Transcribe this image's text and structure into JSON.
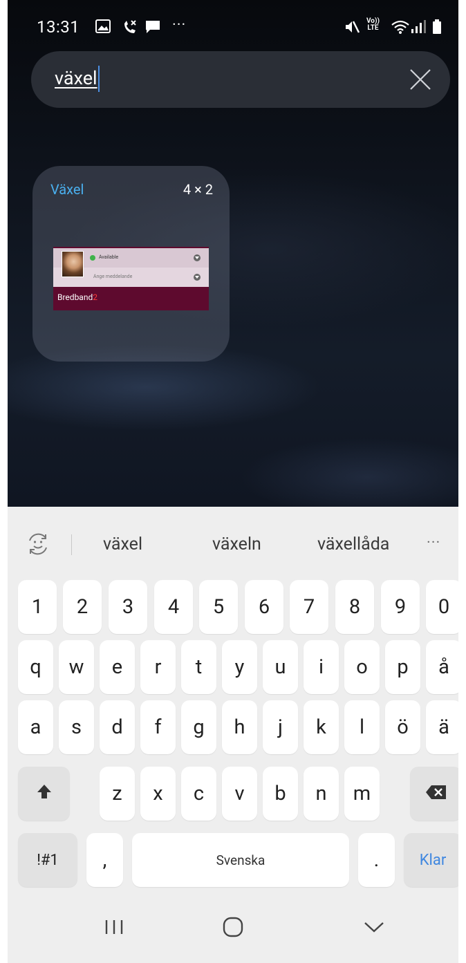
{
  "status_bar": {
    "time": "13:31",
    "more_indicator": "···",
    "volte_line1": "Vo))",
    "volte_line2": "LTE",
    "icons": [
      "gallery-icon",
      "missed-call-icon",
      "message-icon",
      "more-icon",
      "mute-icon",
      "volte-icon",
      "wifi-icon",
      "signal-icon",
      "battery-icon"
    ]
  },
  "search": {
    "query": "växel",
    "clear_icon": "close-icon"
  },
  "widget": {
    "name": "Växel",
    "size": "4 × 2",
    "preview": {
      "status_text": "Available",
      "message_placeholder": "Ange meddelande",
      "brand_text": "Bredband",
      "brand_number": "2",
      "status_color": "#3fb24a",
      "brand_background": "#5e0a2e"
    }
  },
  "keyboard": {
    "suggestions": [
      "växel",
      "växeln",
      "växellåda"
    ],
    "more_suggestions": "···",
    "rows": [
      [
        "1",
        "2",
        "3",
        "4",
        "5",
        "6",
        "7",
        "8",
        "9",
        "0"
      ],
      [
        "q",
        "w",
        "e",
        "r",
        "t",
        "y",
        "u",
        "i",
        "o",
        "p",
        "å"
      ],
      [
        "a",
        "s",
        "d",
        "f",
        "g",
        "h",
        "j",
        "k",
        "l",
        "ö",
        "ä"
      ],
      [
        "z",
        "x",
        "c",
        "v",
        "b",
        "n",
        "m"
      ]
    ],
    "symbols_label": "!#1",
    "comma_label": ",",
    "space_label": "Svenska",
    "period_label": ".",
    "enter_label": "Klar",
    "accent_color": "#3f87e0"
  },
  "navigation": {
    "icons": [
      "recents-icon",
      "home-icon",
      "back-icon"
    ]
  }
}
